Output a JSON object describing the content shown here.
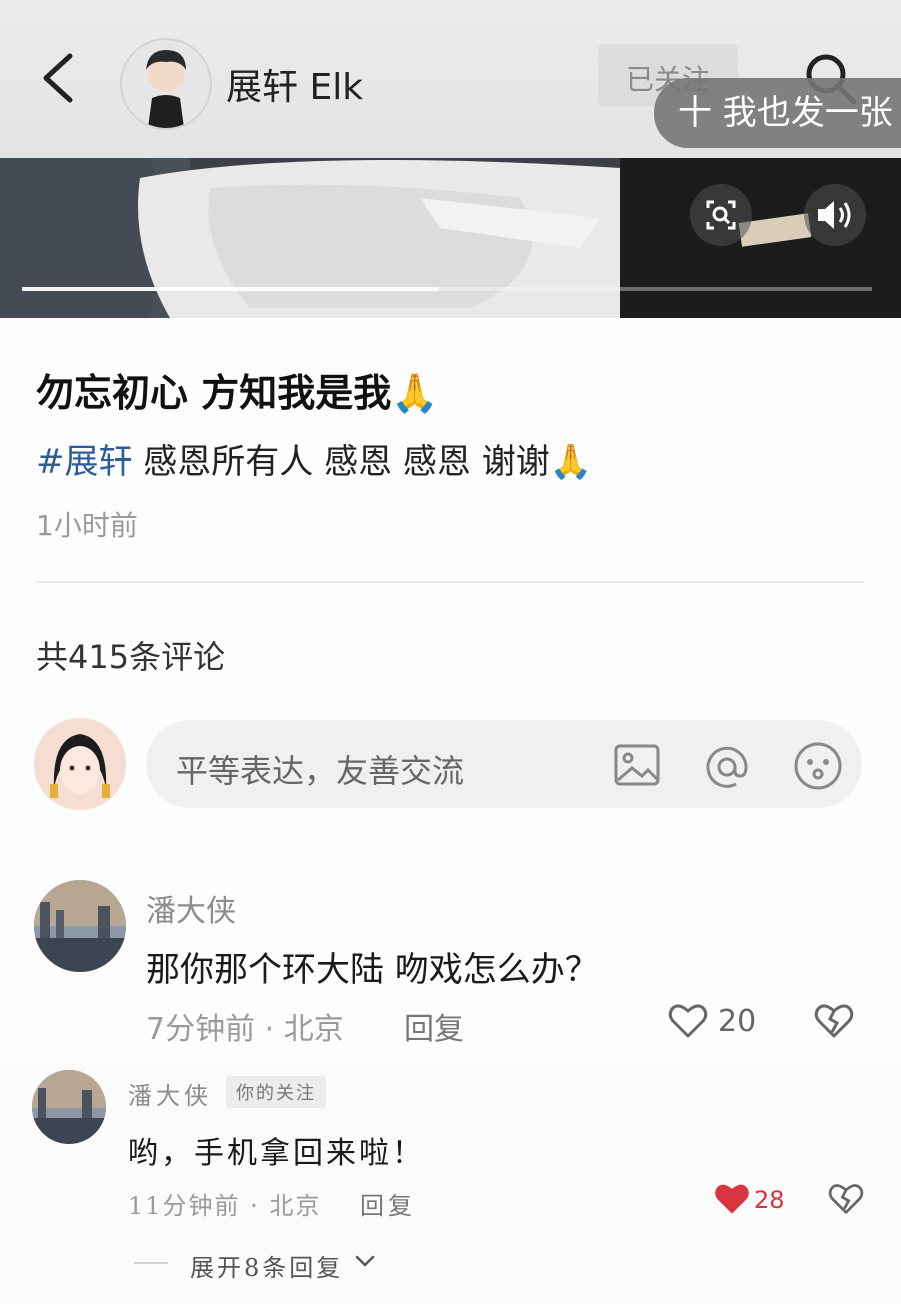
{
  "header": {
    "author_name": "展轩 Elk",
    "follow_status": "已关注",
    "post_too_label": "十 我也发一张"
  },
  "video": {
    "progress": 0.49
  },
  "post": {
    "title": "勿忘初心 方知我是我🙏",
    "hashtag": "#展轩",
    "body": " 感恩所有人 感恩 感恩 谢谢🙏",
    "time": "1小时前"
  },
  "comments_section": {
    "count_label": "共415条评论",
    "input_placeholder": "平等表达，友善交流"
  },
  "comments": [
    {
      "user": "潘大侠",
      "text": "那你那个环大陆 吻戏怎么办？",
      "meta": "7分钟前 · 北京",
      "reply_label": "回复",
      "likes": "20",
      "liked": false
    },
    {
      "user": "潘大侠",
      "badge": "你的关注",
      "text": "哟，手机拿回来啦！",
      "meta": "11分钟前 · 北京",
      "reply_label": "回复",
      "likes": "28",
      "liked": true
    }
  ],
  "expand_replies_label": "展开8条回复",
  "colors": {
    "hashtag": "#2c5d99",
    "liked_heart": "#d8333e"
  },
  "icons": [
    "back-icon",
    "search-icon",
    "zoom-icon",
    "sound-icon",
    "image-icon",
    "at-icon",
    "emoji-icon",
    "heart-icon",
    "broken-heart-icon",
    "chevron-down-icon"
  ]
}
